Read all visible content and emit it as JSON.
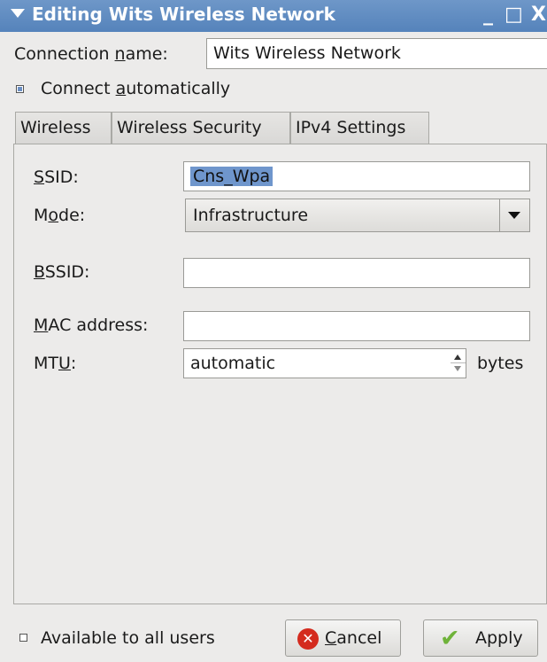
{
  "window": {
    "title": "Editing Wits Wireless Network",
    "minimize_glyph": "_",
    "maximize_glyph": "□",
    "close_glyph": "X"
  },
  "connection": {
    "name_label_pre": "Connection ",
    "name_label_u": "n",
    "name_label_post": "ame:",
    "name_value": "Wits Wireless Network",
    "auto_label_pre": "Connect ",
    "auto_label_u": "a",
    "auto_label_post": "utomatically",
    "auto_checked": true
  },
  "tabs": [
    {
      "label": "Wireless"
    },
    {
      "label": "Wireless Security"
    },
    {
      "label": "IPv4 Settings"
    }
  ],
  "wireless": {
    "ssid_label_u": "S",
    "ssid_label_post": "SID:",
    "ssid_value": "Cns_Wpa",
    "mode_label_pre": "M",
    "mode_label_u": "o",
    "mode_label_post": "de:",
    "mode_value": "Infrastructure",
    "bssid_label_u": "B",
    "bssid_label_post": "SSID:",
    "bssid_value": "",
    "mac_label_u": "M",
    "mac_label_post": "AC address:",
    "mac_value": "",
    "mtu_label_pre": "MT",
    "mtu_label_u": "U",
    "mtu_label_post": ":",
    "mtu_value": "automatic",
    "mtu_unit": "bytes"
  },
  "footer": {
    "all_users_label": "Available to all users",
    "all_users_checked": false,
    "cancel_u": "C",
    "cancel_post": "ancel",
    "apply_label": "Apply"
  },
  "colors": {
    "titlebar": "#5f8bc2",
    "selection": "#6f96cc",
    "cancel_icon": "#d42b1e",
    "apply_icon": "#6fb33a"
  },
  "icons": {
    "cancel": "cancel-x-icon",
    "apply": "checkmark-icon",
    "window_menu": "chevron-down-icon"
  }
}
